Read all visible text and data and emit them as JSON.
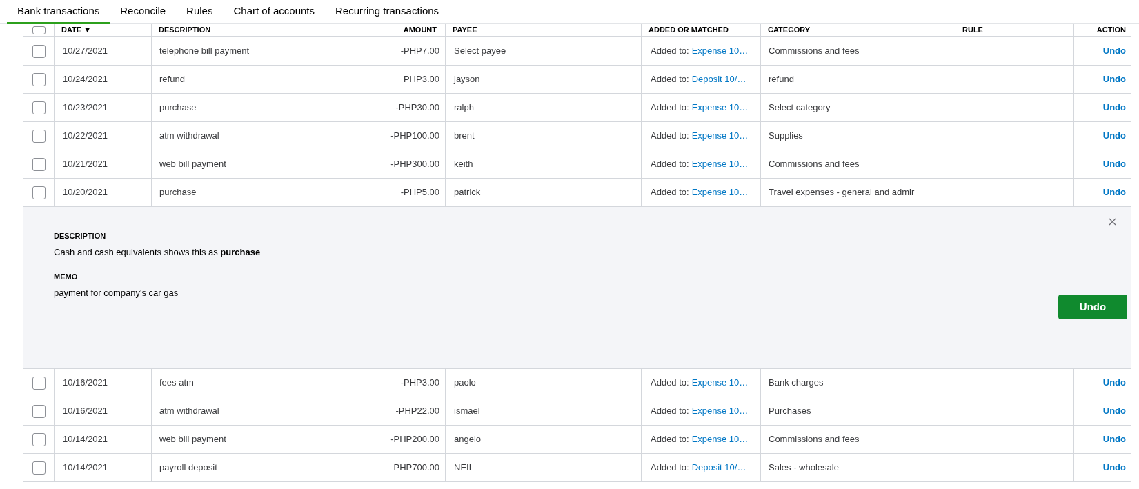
{
  "tabs": [
    {
      "label": "Bank transactions",
      "selected": true
    },
    {
      "label": "Reconcile",
      "selected": false
    },
    {
      "label": "Rules",
      "selected": false
    },
    {
      "label": "Chart of accounts",
      "selected": false
    },
    {
      "label": "Recurring transactions",
      "selected": false
    }
  ],
  "table": {
    "select_all_checked": false,
    "columns": [
      "DATE ▼",
      "DESCRIPTION",
      "AMOUNT",
      "PAYEE",
      "ADDED OR MATCHED",
      "CATEGORY",
      "RULE",
      "ACTION"
    ],
    "rows": [
      {
        "checked": false,
        "date": "10/27/2021",
        "description": "telephone bill payment",
        "amount": "-PHP7.00",
        "payee": "Select payee",
        "added_label": "Added to:",
        "added_link": "Expense 10…",
        "category": "Commissions and fees",
        "action": "Undo"
      },
      {
        "checked": false,
        "date": "10/24/2021",
        "description": "refund",
        "amount": "PHP3.00",
        "payee": "jayson",
        "added_label": "Added to:",
        "added_link": "Deposit 10/…",
        "category": "refund",
        "action": "Undo"
      },
      {
        "checked": false,
        "date": "10/23/2021",
        "description": "purchase",
        "amount": "-PHP30.00",
        "payee": "ralph",
        "added_label": "Added to:",
        "added_link": "Expense 10…",
        "category": "Select category",
        "action": "Undo"
      },
      {
        "checked": false,
        "date": "10/22/2021",
        "description": "atm withdrawal",
        "amount": "-PHP100.00",
        "payee": "brent",
        "added_label": "Added to:",
        "added_link": "Expense 10…",
        "category": "Supplies",
        "action": "Undo"
      },
      {
        "checked": false,
        "date": "10/21/2021",
        "description": "web bill payment",
        "amount": "-PHP300.00",
        "payee": "keith",
        "added_label": "Added to:",
        "added_link": "Expense 10…",
        "category": "Commissions and fees",
        "action": "Undo"
      },
      {
        "checked": false,
        "date": "10/20/2021",
        "description": "purchase",
        "amount": "-PHP5.00",
        "payee": "patrick",
        "added_label": "Added to:",
        "added_link": "Expense 10…",
        "category": "Travel expenses - general and admir",
        "action": "Undo",
        "detail": {
          "description_heading": "DESCRIPTION",
          "description_text": "Cash and cash equivalents shows this as **purchase**",
          "memo_heading": "MEMO",
          "memo_text": "payment for company's car gas",
          "button": "Undo"
        }
      },
      {
        "checked": false,
        "date": "10/16/2021",
        "description": "fees atm",
        "amount": "-PHP3.00",
        "payee": "paolo",
        "added_label": "Added to:",
        "added_link": "Expense 10…",
        "category": "Bank charges",
        "action": "Undo"
      },
      {
        "checked": false,
        "date": "10/16/2021",
        "description": "atm withdrawal",
        "amount": "-PHP22.00",
        "payee": "ismael",
        "added_label": "Added to:",
        "added_link": "Expense 10…",
        "category": "Purchases",
        "action": "Undo"
      },
      {
        "checked": false,
        "date": "10/14/2021",
        "description": "web bill payment",
        "amount": "-PHP200.00",
        "payee": "angelo",
        "added_label": "Added to:",
        "added_link": "Expense 10…",
        "category": "Commissions and fees",
        "action": "Undo"
      },
      {
        "checked": false,
        "date": "10/14/2021",
        "description": "payroll deposit",
        "amount": "PHP700.00",
        "payee": "NEIL",
        "added_label": "Added to:",
        "added_link": "Deposit 10/…",
        "category": "Sales - wholesale",
        "action": "Undo"
      }
    ]
  }
}
